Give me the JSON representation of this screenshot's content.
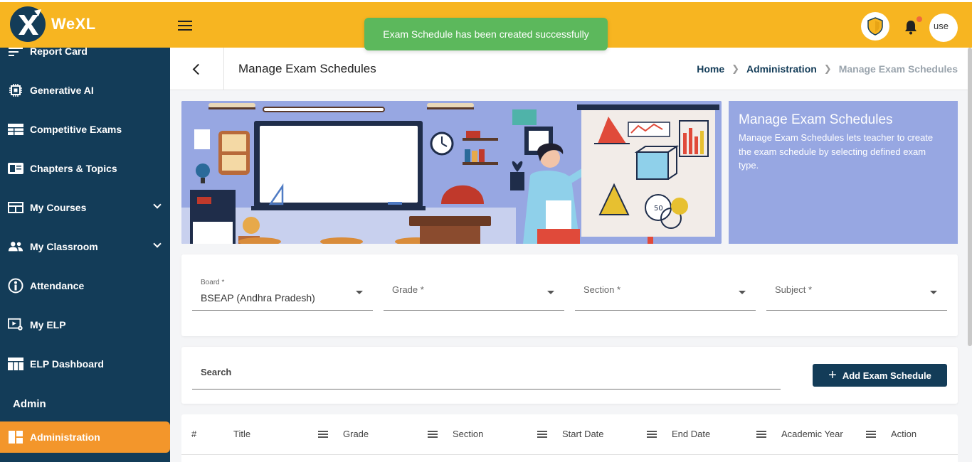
{
  "app": {
    "name": "WeXL"
  },
  "toast": {
    "message": "Exam Schedule has been created successfully"
  },
  "header": {
    "avatar_alt": "use"
  },
  "sidebar": {
    "items": [
      {
        "label": "Report Card",
        "icon": "list-icon"
      },
      {
        "label": "Generative AI",
        "icon": "chip-icon"
      },
      {
        "label": "Competitive Exams",
        "icon": "table-icon"
      },
      {
        "label": "Chapters & Topics",
        "icon": "book-icon"
      },
      {
        "label": "My Courses",
        "icon": "courses-icon"
      },
      {
        "label": "My Classroom",
        "icon": "group-icon"
      },
      {
        "label": "Attendance",
        "icon": "person-circle-icon"
      },
      {
        "label": "My ELP",
        "icon": "video-settings-icon"
      },
      {
        "label": "ELP Dashboard",
        "icon": "dashboard-icon"
      }
    ],
    "section_label": "Admin",
    "active_item": {
      "label": "Administration",
      "icon": "grid-icon"
    }
  },
  "page": {
    "title": "Manage Exam Schedules",
    "breadcrumb": [
      "Home",
      "Administration",
      "Manage Exam Schedules"
    ]
  },
  "info_card": {
    "title": "Manage Exam Schedules",
    "description": "Manage Exam Schedules lets teacher to create the exam schedule by selecting defined exam type."
  },
  "filters": {
    "board": {
      "label": "Board *",
      "value": "BSEAP (Andhra Pradesh)"
    },
    "grade": {
      "label": "Grade *"
    },
    "section": {
      "label": "Section *"
    },
    "subject": {
      "label": "Subject *"
    }
  },
  "search": {
    "placeholder": "Search"
  },
  "add_button": {
    "label": "Add Exam Schedule"
  },
  "table": {
    "columns": [
      "#",
      "Title",
      "Grade",
      "Section",
      "Start Date",
      "End Date",
      "Academic Year",
      "Action"
    ]
  },
  "colors": {
    "topbar": "#f7b521",
    "sidebar": "#133c58",
    "active": "#f3962b",
    "toast": "#5cb85c",
    "banner": "#97a7e2"
  }
}
